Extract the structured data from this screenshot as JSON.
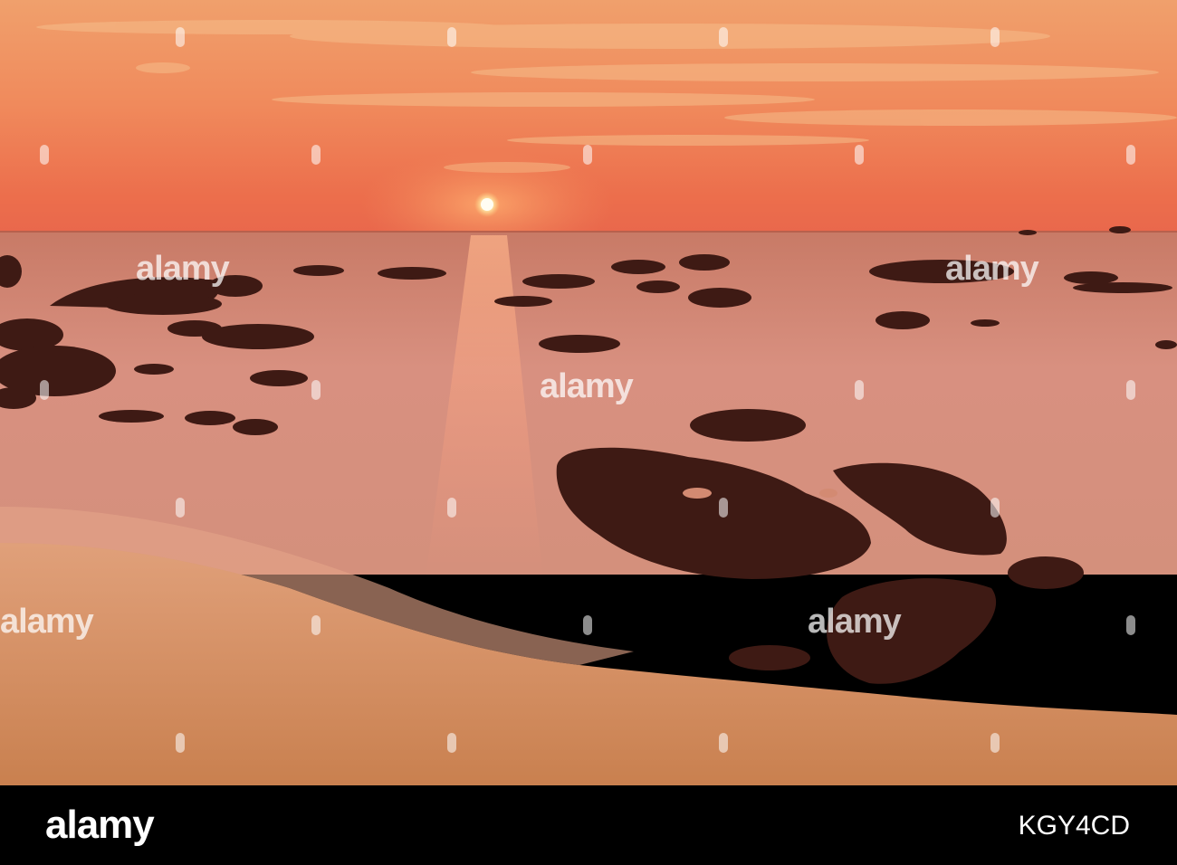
{
  "watermark": {
    "brand_text": "alamy"
  },
  "footer": {
    "logo_text": "alamy",
    "image_code": "KGY4CD"
  },
  "colors": {
    "sky_top": "#f2a26a",
    "sky_horizon": "#e8664a",
    "sea": "#d78f79",
    "sand": "#d58d62",
    "rock": "#3e1a14"
  }
}
